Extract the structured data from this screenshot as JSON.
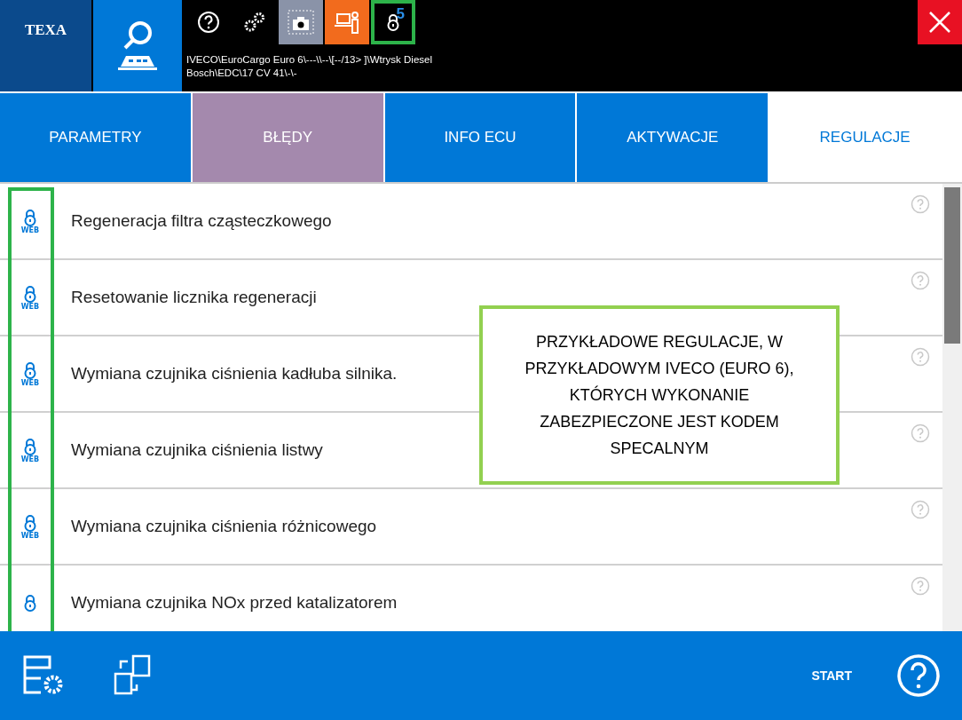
{
  "header": {
    "logo": "TEXA",
    "toolbar": [
      {
        "kind": "help"
      },
      {
        "kind": "gears"
      },
      {
        "kind": "camera",
        "color": "#8a93a8"
      },
      {
        "kind": "operator",
        "color": "#f26b1d"
      },
      {
        "kind": "lock",
        "badge": "5",
        "highlighted": true
      }
    ],
    "path": "IVECO\\EuroCargo Euro 6\\---\\\\--\\[--/13> ]\\Wtrysk Diesel Bosch\\EDC\\17 CV 41\\-\\-"
  },
  "tabs": [
    {
      "label": "PARAMETRY",
      "selected": false,
      "alert": false
    },
    {
      "label": "BŁĘDY",
      "selected": false,
      "alert": true
    },
    {
      "label": "INFO ECU",
      "selected": false,
      "alert": false
    },
    {
      "label": "AKTYWACJE",
      "selected": false,
      "alert": false
    },
    {
      "label": "REGULACJE",
      "selected": true,
      "alert": false
    }
  ],
  "rows": [
    {
      "lock_label": "WEB",
      "name": "Regeneracja filtra cząsteczkowego"
    },
    {
      "lock_label": "WEB",
      "name": "Resetowanie licznika regeneracji"
    },
    {
      "lock_label": "WEB",
      "name": "Wymiana czujnika ciśnienia kadłuba silnika."
    },
    {
      "lock_label": "WEB",
      "name": "Wymiana czujnika ciśnienia listwy"
    },
    {
      "lock_label": "WEB",
      "name": "Wymiana czujnika ciśnienia różnicowego"
    },
    {
      "name": "Wymiana czujnika NOx przed katalizatorem"
    }
  ],
  "annotation": "PRZYKŁADOWE REGULACJE, W PRZYKŁADOWYM IVECO (EURO 6), KTÓRYCH WYKONANIE ZABEZPIECZONE JEST KODEM SPECALNYM",
  "footer": {
    "start": "START"
  }
}
